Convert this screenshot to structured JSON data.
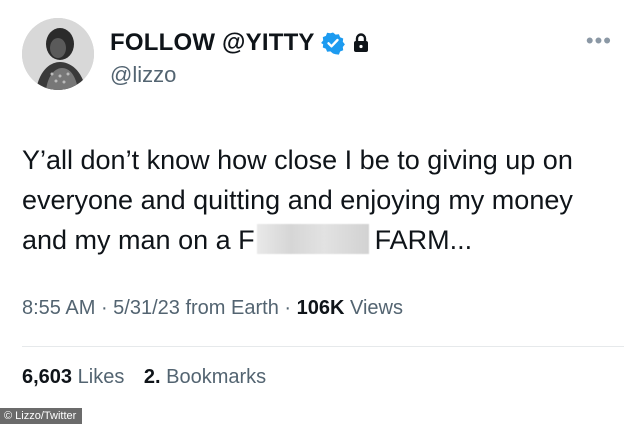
{
  "author": {
    "display_name": "FOLLOW @YITTY",
    "handle": "@lizzo",
    "verified_color": "#1d9bf0"
  },
  "tweet": {
    "line1": "Y’all don’t know how close I be to giving up on",
    "line2": "everyone and quitting and enjoying my money",
    "line3_start": "and my man on a F",
    "line3_end": "FARM..."
  },
  "meta": {
    "time": "8:55 AM",
    "date": "5/31/23",
    "source": "from Earth",
    "views_count": "106K",
    "views_label": "Views"
  },
  "stats": {
    "likes_count": "6,603",
    "likes_label": "Likes",
    "bookmarks_count": "2.",
    "bookmarks_label": "Bookmarks"
  },
  "credit": "© Lizzo/Twitter",
  "icons": {
    "more": "more-icon",
    "verified": "verified-badge-icon",
    "lock": "lock-icon"
  }
}
